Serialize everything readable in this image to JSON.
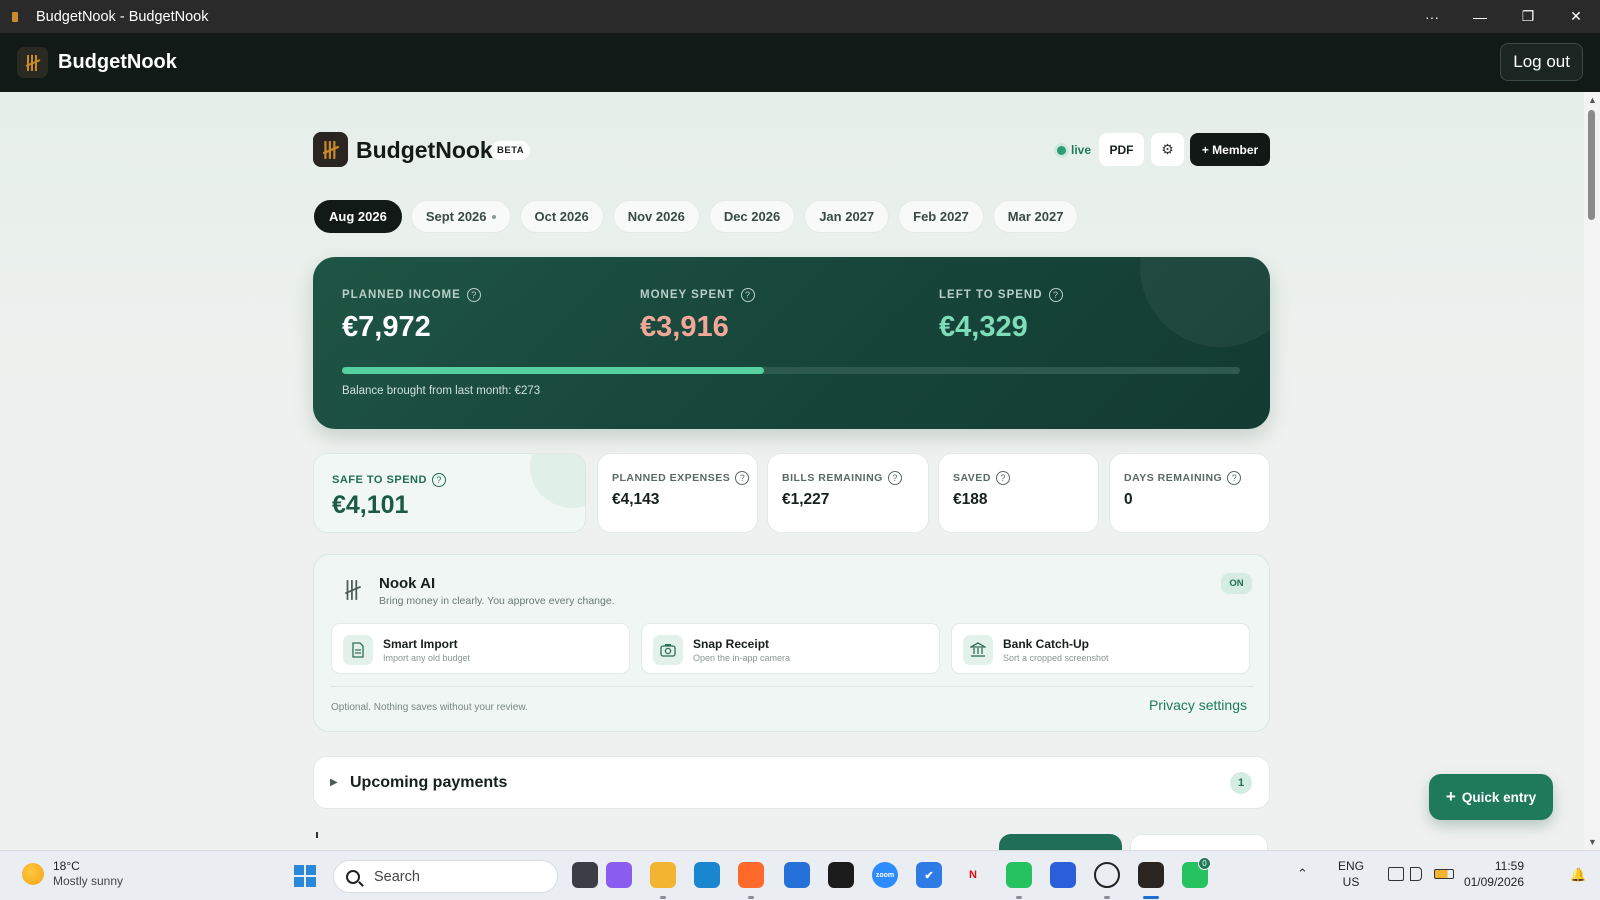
{
  "window": {
    "title": "BudgetNook - BudgetNook",
    "controls": {
      "more": "···",
      "minimize": "—",
      "maximize": "❐",
      "close": "✕"
    }
  },
  "appbar": {
    "brand": "BudgetNook",
    "logout_label": "Log out"
  },
  "header": {
    "brand": "BudgetNook",
    "beta_badge": "BETA",
    "live_label": "live",
    "pdf_label": "PDF",
    "settings_icon": "gear-icon",
    "settings_glyph": "⚙",
    "member_label": "+ Member"
  },
  "months": [
    {
      "label": "Aug 2026",
      "active": true,
      "dot": false
    },
    {
      "label": "Sept 2026",
      "active": false,
      "dot": true
    },
    {
      "label": "Oct 2026",
      "active": false,
      "dot": false
    },
    {
      "label": "Nov 2026",
      "active": false,
      "dot": false
    },
    {
      "label": "Dec 2026",
      "active": false,
      "dot": false
    },
    {
      "label": "Jan 2027",
      "active": false,
      "dot": false
    },
    {
      "label": "Feb 2027",
      "active": false,
      "dot": false
    },
    {
      "label": "Mar 2027",
      "active": false,
      "dot": false
    }
  ],
  "summary": {
    "planned_income": {
      "label": "PLANNED INCOME",
      "value": "€7,972",
      "color": "#ffffff"
    },
    "money_spent": {
      "label": "MONEY SPENT",
      "value": "€3,916",
      "color": "#f3a799"
    },
    "left_to_spend": {
      "label": "LEFT TO SPEND",
      "value": "€4,329",
      "color": "#7fdcb8"
    },
    "help_glyph": "?",
    "spent_fraction": 0.47,
    "carryover": "Balance brought from last month: €273"
  },
  "stats": {
    "safe_to_spend": {
      "label": "SAFE TO SPEND",
      "value": "€4,101"
    },
    "planned_expenses": {
      "label": "PLANNED EXPENSES",
      "value": "€4,143"
    },
    "bills_remaining": {
      "label": "BILLS REMAINING",
      "value": "€1,227"
    },
    "saved": {
      "label": "SAVED",
      "value": "€188"
    },
    "days_remaining": {
      "label": "DAYS REMAINING",
      "value": "0"
    }
  },
  "nook_ai": {
    "title": "Nook AI",
    "subtitle": "Bring money in clearly. You approve every change.",
    "status": "ON",
    "tools": [
      {
        "name": "Smart Import",
        "desc": "Import any old budget",
        "icon": "document-icon"
      },
      {
        "name": "Snap Receipt",
        "desc": "Open the in-app camera",
        "icon": "camera-icon"
      },
      {
        "name": "Bank Catch-Up",
        "desc": "Sort a cropped screenshot",
        "icon": "bank-icon"
      }
    ],
    "footer": "Optional. Nothing saves without your review.",
    "privacy_link": "Privacy settings"
  },
  "upcoming": {
    "title": "Upcoming payments",
    "count": "1",
    "caret": "▶"
  },
  "quick_entry": {
    "label": "Quick entry",
    "glyph": "+"
  },
  "taskbar": {
    "weather_temp": "18°C",
    "weather_condition": "Mostly sunny",
    "search_placeholder": "Search",
    "apps": [
      {
        "name": "task-view-icon",
        "color": "#3b3f45",
        "glyph": ""
      },
      {
        "name": "copilot-icon",
        "color": "#8a5cf0",
        "glyph": ""
      },
      {
        "name": "file-explorer-icon",
        "color": "#f2b431",
        "glyph": ""
      },
      {
        "name": "edge-icon",
        "color": "#1a86d0",
        "glyph": ""
      },
      {
        "name": "firefox-icon",
        "color": "#ff6a2b",
        "glyph": ""
      },
      {
        "name": "store-icon",
        "color": "#2671d9",
        "glyph": ""
      },
      {
        "name": "nvidia-icon",
        "color": "#1b1b1b",
        "glyph": ""
      },
      {
        "name": "zoom-icon",
        "color": "#2d8cff",
        "glyph": "zoom"
      },
      {
        "name": "todo-icon",
        "color": "#2f7be5",
        "glyph": "✔"
      },
      {
        "name": "netflix-icon",
        "color": "#ffffff",
        "glyph": "N"
      },
      {
        "name": "whatsapp-icon",
        "color": "#25c35f",
        "glyph": ""
      },
      {
        "name": "calculator-icon",
        "color": "#2b5fd9",
        "glyph": ""
      },
      {
        "name": "chatgpt-icon",
        "color": "#ffffff",
        "glyph": ""
      },
      {
        "name": "budgetnook-icon",
        "color": "#2a2520",
        "glyph": ""
      },
      {
        "name": "whatsapp-beta-icon",
        "color": "#25c35f",
        "glyph": ""
      }
    ],
    "whatsapp_badge": "0",
    "lang_top": "ENG",
    "lang_bottom": "US",
    "time": "11:59",
    "date": "01/09/2026"
  }
}
